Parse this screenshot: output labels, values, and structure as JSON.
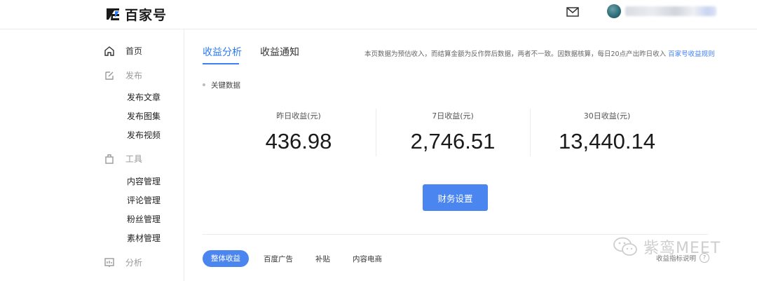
{
  "header": {
    "logo_text": "百家号",
    "icons": {
      "mail": "mail-icon",
      "logo": "baijiahao-logo-icon"
    }
  },
  "sidebar": {
    "items": [
      {
        "label": "首页",
        "icon": "home-icon"
      },
      {
        "label": "发布",
        "icon": "edit-icon",
        "children": [
          "发布文章",
          "发布图集",
          "发布视频"
        ]
      },
      {
        "label": "工具",
        "icon": "toolbox-icon",
        "children": [
          "内容管理",
          "评论管理",
          "粉丝管理",
          "素材管理"
        ]
      },
      {
        "label": "分析",
        "icon": "analytics-icon"
      }
    ]
  },
  "main": {
    "tabs": [
      {
        "label": "收益分析",
        "active": true
      },
      {
        "label": "收益通知",
        "active": false
      }
    ],
    "notice": "本页数据为预估收入，而结算金额为反作弊后数据，两者不一致。因数据核算，每日20点产出昨日收入",
    "notice_link": "百家号收益规则",
    "section_label": "关键数据",
    "stats": [
      {
        "label": "昨日收益(元)",
        "value": "436.98"
      },
      {
        "label": "7日收益(元)",
        "value": "2,746.51"
      },
      {
        "label": "30日收益(元)",
        "value": "13,440.14"
      }
    ],
    "finance_button": "财务设置",
    "subtabs": [
      "整体收益",
      "百度广告",
      "补贴",
      "内容电商"
    ],
    "help_label": "收益指标说明",
    "help_icon": "?"
  },
  "watermark": {
    "text": "紫鸾MEET",
    "icon": "wechat-icon"
  },
  "colors": {
    "accent": "#4b86f0",
    "link": "#3d7ff5"
  }
}
